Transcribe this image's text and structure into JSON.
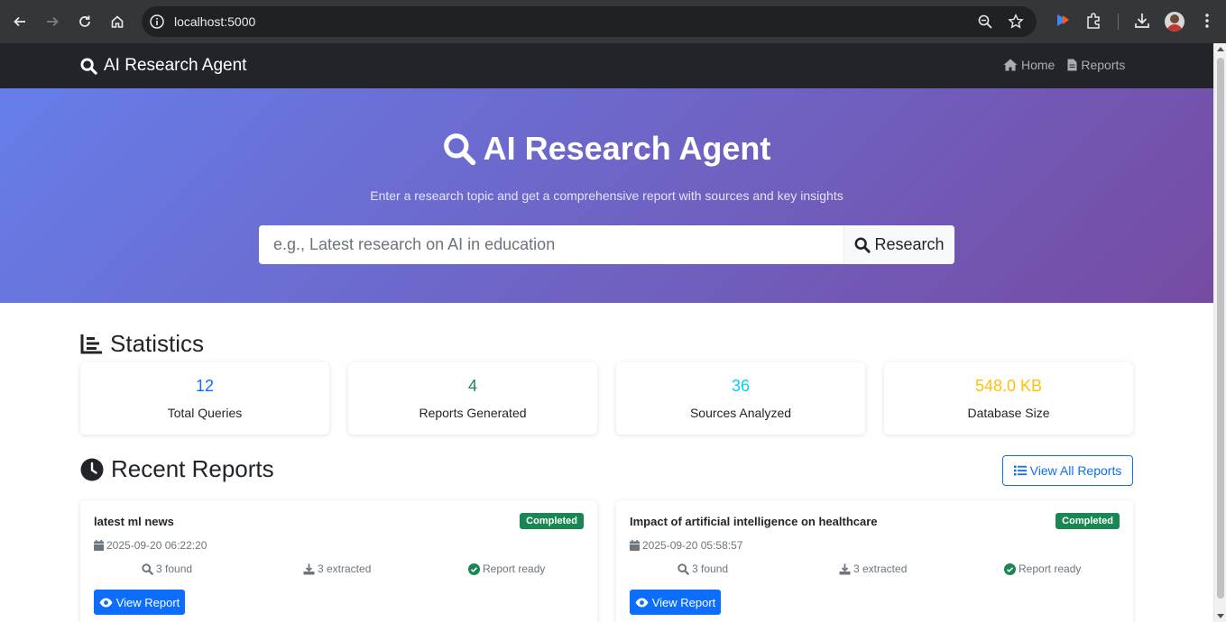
{
  "browser": {
    "url": "localhost:5000"
  },
  "navbar": {
    "brand": "AI Research Agent",
    "links": [
      {
        "label": "Home",
        "icon": "home-icon"
      },
      {
        "label": "Reports",
        "icon": "file-icon"
      }
    ]
  },
  "hero": {
    "title": "AI Research Agent",
    "subtitle": "Enter a research topic and get a comprehensive report with sources and key insights",
    "search_placeholder": "e.g., Latest research on AI in education",
    "search_button": "Research"
  },
  "statistics": {
    "heading": "Statistics",
    "cards": [
      {
        "value": "12",
        "label": "Total Queries",
        "color": "#0d6efd"
      },
      {
        "value": "4",
        "label": "Reports Generated",
        "color": "#198754"
      },
      {
        "value": "36",
        "label": "Sources Analyzed",
        "color": "#0dcaf0"
      },
      {
        "value": "548.0 KB",
        "label": "Database Size",
        "color": "#ffc107"
      }
    ]
  },
  "recent_reports": {
    "heading": "Recent Reports",
    "view_all": "View All Reports",
    "items": [
      {
        "title": "latest ml news",
        "status": "Completed",
        "date": "2025-09-20 06:22:20",
        "found": "3 found",
        "extracted": "3 extracted",
        "ready": "Report ready",
        "button": "View Report"
      },
      {
        "title": "Impact of artificial intelligence on healthcare",
        "status": "Completed",
        "date": "2025-09-20 05:58:57",
        "found": "3 found",
        "extracted": "3 extracted",
        "ready": "Report ready",
        "button": "View Report"
      }
    ]
  }
}
